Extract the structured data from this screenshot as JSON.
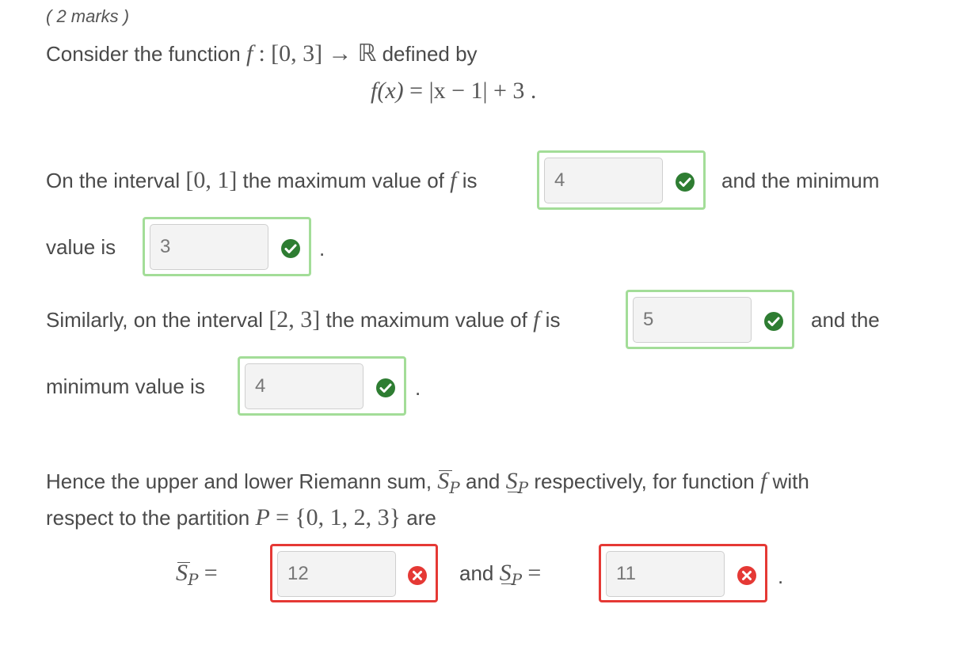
{
  "marks_label": "( 2 marks )",
  "intro": {
    "text": "Consider the function",
    "f": "f",
    "colon": ":",
    "domain": "[0, 3]",
    "arrow": "→",
    "codomain": "ℝ",
    "defined": "defined by"
  },
  "formula": {
    "lhs": "f(x)",
    "eq": "=",
    "rhs": "|x − 1| + 3 ."
  },
  "q1": {
    "prefix": "On the interval",
    "interval": "[0, 1]",
    "middle": "the maximum value of",
    "f": "f",
    "is": "is",
    "after": "and the minimum",
    "line2": "value is",
    "period": ".",
    "max_value": "4",
    "min_value": "3"
  },
  "q2": {
    "prefix": "Similarly, on the interval",
    "interval": "[2, 3]",
    "middle": "the maximum value of",
    "f": "f",
    "is": "is",
    "after": "and the",
    "line2": "minimum value is",
    "period": ".",
    "max_value": "5",
    "min_value": "4"
  },
  "q3": {
    "line1_a": "Hence the upper and lower Riemann sum,",
    "S": "S",
    "P": "P",
    "and": "and",
    "line1_b": "respectively, for function",
    "f": "f",
    "with": "with",
    "line2_a": "respect to the partition",
    "partition_eq": "=",
    "partition_set": "{0, 1, 2, 3}",
    "are": "are",
    "eq": "=",
    "and2": "and",
    "period": ".",
    "upper_value": "12",
    "lower_value": "11"
  },
  "status_colors": {
    "correct_border": "#a3dd98",
    "incorrect_border": "#e53935",
    "correct_icon": "#2e7d32",
    "incorrect_icon": "#e53935"
  },
  "icons": {
    "correct": "check-circle-icon",
    "incorrect": "x-circle-icon"
  }
}
